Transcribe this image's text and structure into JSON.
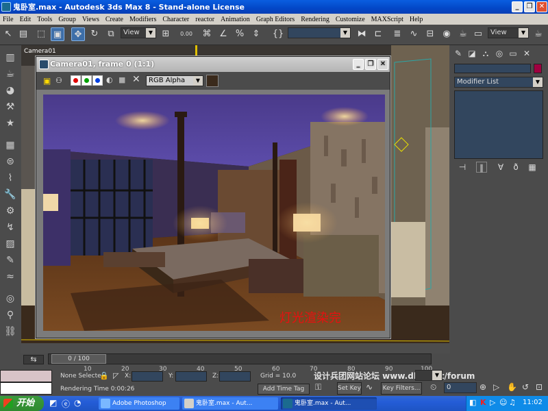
{
  "window": {
    "title": "鬼卧室.max - Autodesk 3ds Max 8  - Stand-alone License"
  },
  "menu": [
    "File",
    "Edit",
    "Tools",
    "Group",
    "Views",
    "Create",
    "Modifiers",
    "Character",
    "reactor",
    "Animation",
    "Graph Editors",
    "Rendering",
    "Customize",
    "MAXScript",
    "Help"
  ],
  "toolbar": {
    "view_combo": "View",
    "view_combo_right": "View",
    "snap_value": "0.00"
  },
  "viewport": {
    "label": "Camera01"
  },
  "render_frame": {
    "title": "Camera01, frame 0 (1:1)",
    "channel": "RGB Alpha",
    "overlay_text": "灯光渲染完"
  },
  "command_panel": {
    "modifier_list": "Modifier List",
    "name_color": "#a00040"
  },
  "timeline": {
    "frame": "0 / 100",
    "ticks": [
      "10",
      "20",
      "30",
      "40",
      "50",
      "60",
      "70",
      "80",
      "90",
      "100"
    ]
  },
  "status": {
    "selection": "None Selecte",
    "x_label": "X:",
    "y_label": "Y:",
    "z_label": "Z:",
    "grid": "Grid = 10.0",
    "render_time": "Rendering Time 0:00:26",
    "add_time_tag": "Add Time Tag",
    "set_key": "Set Key",
    "key_filters": "Key Filters...",
    "frame_field": "0",
    "watermark": "设计兵团网站论坛  www.dlwcnet/forum"
  },
  "taskbar": {
    "start": "开始",
    "items": [
      "Adobe Photoshop",
      "鬼卧室.max - Aut...",
      "鬼卧室.max - Aut..."
    ],
    "clock": "11:02"
  }
}
